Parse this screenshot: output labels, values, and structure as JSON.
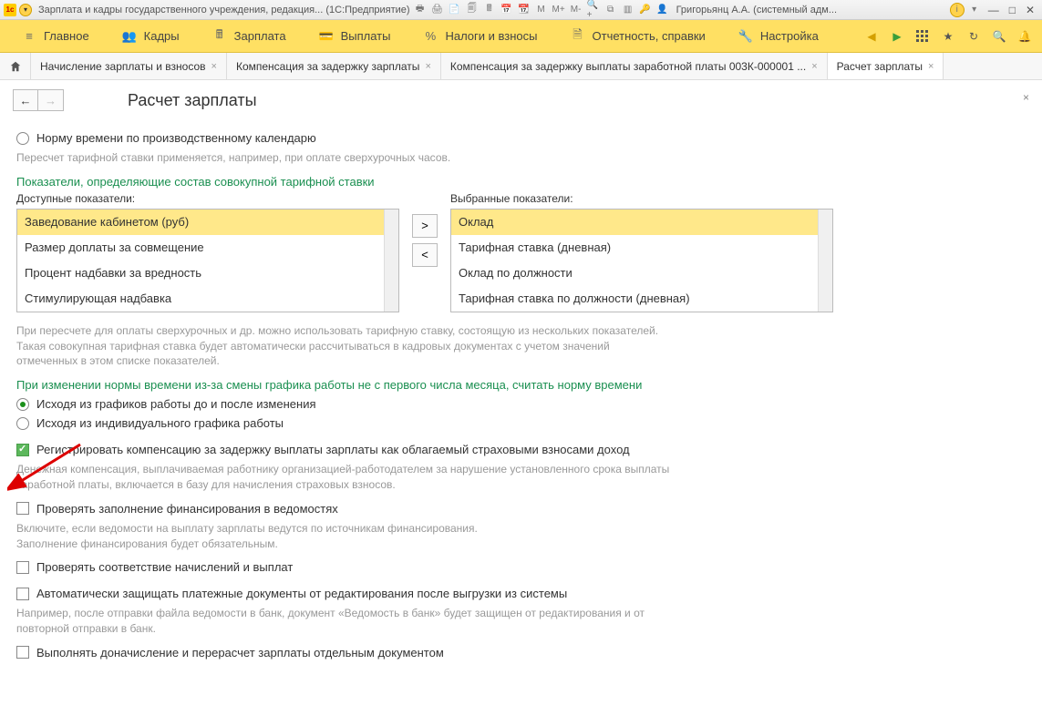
{
  "titlebar": {
    "app_title": "Зарплата и кадры государственного учреждения, редакция...   (1С:Предприятие)",
    "user": "Григорьянц А.А. (системный адм..."
  },
  "menu": {
    "items": [
      {
        "label": "Главное"
      },
      {
        "label": "Кадры"
      },
      {
        "label": "Зарплата"
      },
      {
        "label": "Выплаты"
      },
      {
        "label": "Налоги и взносы"
      },
      {
        "label": "Отчетность, справки"
      },
      {
        "label": "Настройка"
      }
    ]
  },
  "tabs": [
    {
      "label": "Начисление зарплаты и взносов"
    },
    {
      "label": "Компенсация за задержку зарплаты"
    },
    {
      "label": "Компенсация за задержку выплаты заработной платы 003К-000001 ..."
    },
    {
      "label": "Расчет зарплаты",
      "active": true
    }
  ],
  "page": {
    "title": "Расчет зарплаты"
  },
  "form": {
    "radio_norm": "Норму времени по производственному календарю",
    "hint_recalc": "Пересчет тарифной ставки применяется, например, при оплате сверхурочных часов.",
    "green_indicators": "Показатели, определяющие состав совокупной тарифной ставки",
    "available_label": "Доступные показатели:",
    "selected_label": "Выбранные показатели:",
    "available": [
      "Заведование кабинетом (руб)",
      "Размер доплаты за совмещение",
      "Процент надбавки за вредность",
      "Стимулирующая надбавка"
    ],
    "selected": [
      "Оклад",
      "Тарифная ставка (дневная)",
      "Оклад по должности",
      "Тарифная ставка по должности (дневная)"
    ],
    "hint_overtime": "При пересчете для оплаты сверхурочных и др. можно использовать тарифную ставку, состоящую из нескольких показателей. Такая совокупная тарифная ставка будет автоматически рассчитываться в кадровых документах с учетом значений отмеченных в этом списке показателей.",
    "green_norm_change": "При изменении нормы времени из-за смены графика работы не с первого числа месяца, считать норму времени",
    "radio_graphs": "Исходя из графиков работы до и после изменения",
    "radio_individual": "Исходя из индивидуального графика работы",
    "check_compensation": "Регистрировать компенсацию за задержку выплаты зарплаты как облагаемый страховыми взносами доход",
    "hint_compensation": "Денежная компенсация, выплачиваемая работнику организацией-работодателем за нарушение установленного срока выплаты заработной платы, включается в базу для начисления страховых взносов.",
    "check_financing": "Проверять заполнение финансирования в ведомостях",
    "hint_financing": "Включите, если ведомости на выплату зарплаты ведутся по источникам финансирования.\nЗаполнение финансирования будет обязательным.",
    "check_match": "Проверять соответствие начислений и выплат",
    "check_protect": "Автоматически защищать платежные документы от редактирования после выгрузки из системы",
    "hint_protect": "Например, после отправки файла ведомости в банк, документ «Ведомость в банк» будет защищен от редактирования и от повторной отправки в банк.",
    "check_recalc": "Выполнять доначисление и перерасчет зарплаты отдельным документом"
  }
}
